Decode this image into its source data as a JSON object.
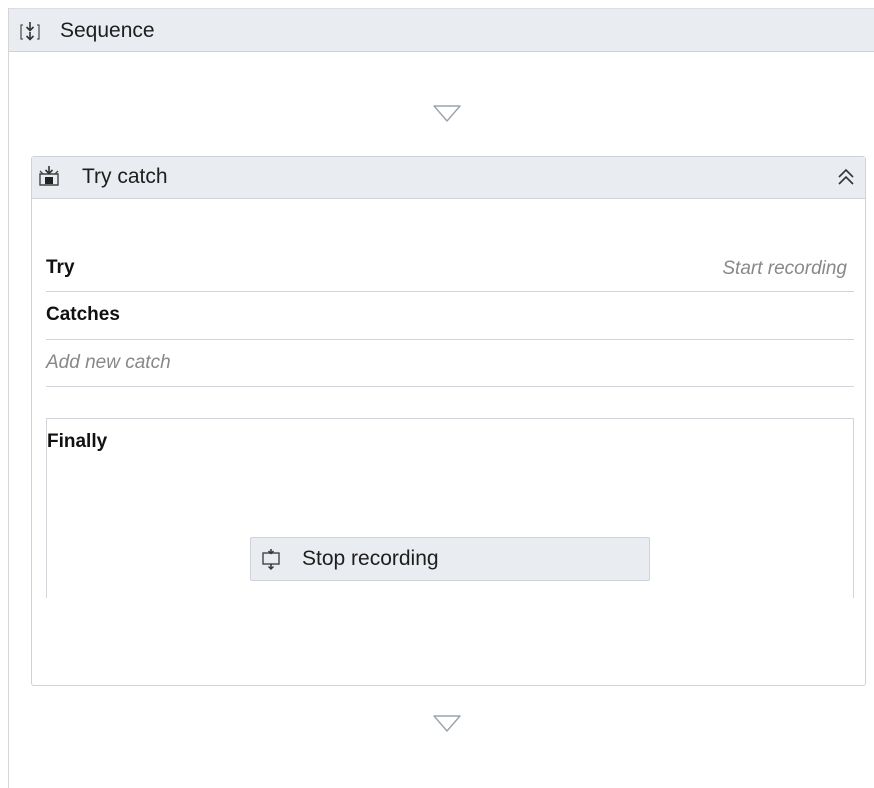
{
  "sequence": {
    "title": "Sequence",
    "icon": "sequence-icon"
  },
  "try_catch": {
    "title": "Try catch",
    "icon": "try-catch-icon",
    "collapse_icon": "double-chevron-up-icon",
    "try_label": "Try",
    "try_hint": "Start recording",
    "catches_label": "Catches",
    "add_catch_hint": "Add new catch",
    "finally_label": "Finally"
  },
  "finally_action": {
    "label": "Stop recording",
    "icon": "stop-recording-icon"
  },
  "drop_target_icon": "drop-target-arrow-icon",
  "colors": {
    "header_bg": "#e9ecf0",
    "border": "#cfd3d8",
    "hint_text": "#888888"
  }
}
